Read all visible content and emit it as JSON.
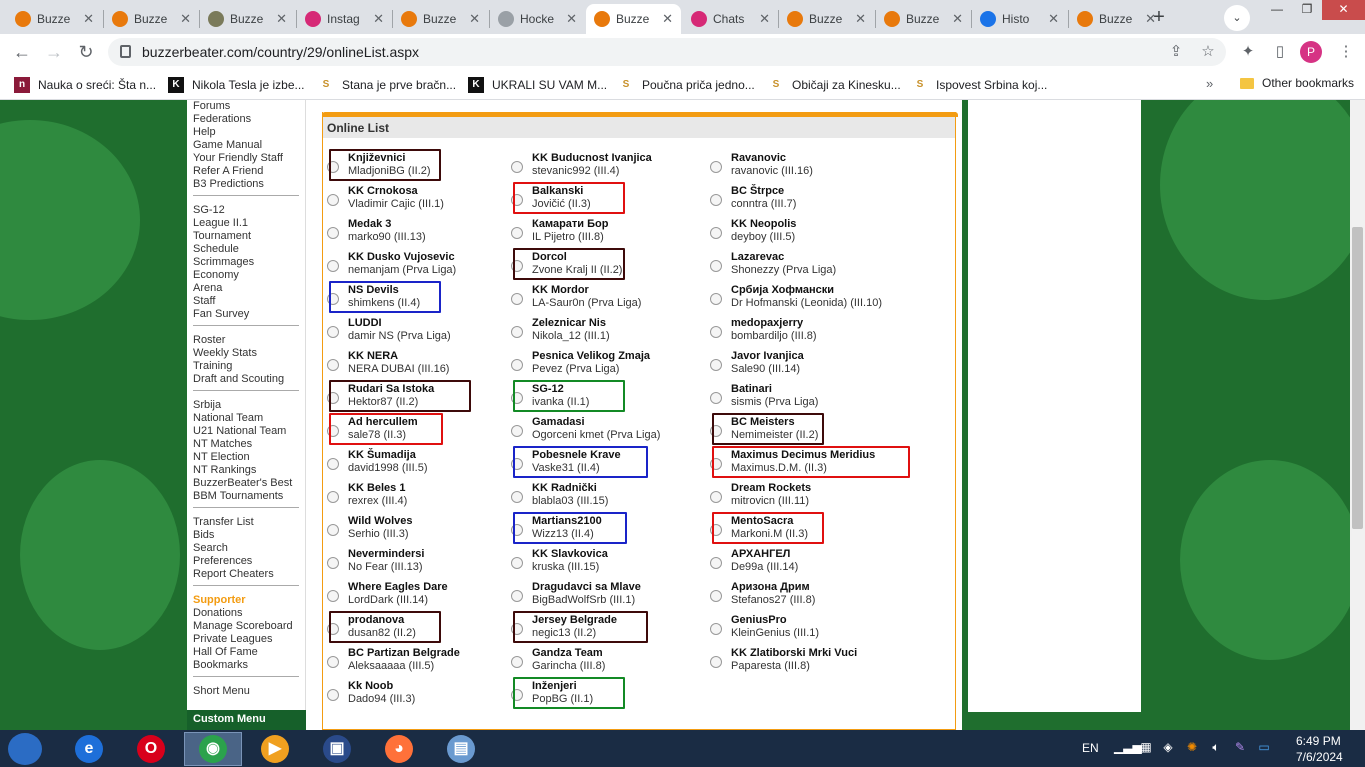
{
  "browser": {
    "tabs": [
      {
        "title": "Buzze",
        "favicon": "basketball-icon",
        "color": "#e8790c"
      },
      {
        "title": "Buzze",
        "favicon": "basketball-icon",
        "color": "#e8790c"
      },
      {
        "title": "Buzze",
        "favicon": "bm-icon",
        "color": "#7a7a5a"
      },
      {
        "title": "Instag",
        "favicon": "instagram-icon",
        "color": "#d62976"
      },
      {
        "title": "Buzze",
        "favicon": "basketball-icon",
        "color": "#e8790c"
      },
      {
        "title": "Hocke",
        "favicon": "link-icon",
        "color": "#9aa0a6"
      },
      {
        "title": "Buzze",
        "favicon": "basketball-icon",
        "color": "#e8790c"
      },
      {
        "title": "Chats",
        "favicon": "instagram-icon",
        "color": "#d62976"
      },
      {
        "title": "Buzze",
        "favicon": "basketball-icon",
        "color": "#e8790c"
      },
      {
        "title": "Buzze",
        "favicon": "basketball-icon",
        "color": "#e8790c"
      },
      {
        "title": "Histo",
        "favicon": "history-icon",
        "color": "#1a73e8"
      },
      {
        "title": "Buzze",
        "favicon": "basketball-icon",
        "color": "#e8790c"
      }
    ],
    "active_tab": 6,
    "url": "buzzerbeater.com/country/29/onlineList.aspx",
    "profile_initial": "P",
    "bookmarks": [
      {
        "label": "Nauka o sreći: Šta n...",
        "icon": "n-icon",
        "glyph": "n",
        "bg": "#8b1a3a",
        "fg": "#fff"
      },
      {
        "label": "Nikola Tesla je izbe...",
        "icon": "k-icon",
        "glyph": "K",
        "bg": "#111",
        "fg": "#fff"
      },
      {
        "label": "Stana je prve bračn...",
        "icon": "s-icon",
        "glyph": "S",
        "bg": "transparent",
        "fg": "#c8912a"
      },
      {
        "label": "UKRALI SU VAM M...",
        "icon": "k-icon",
        "glyph": "K",
        "bg": "#111",
        "fg": "#fff"
      },
      {
        "label": "Poučna priča jedno...",
        "icon": "s-icon",
        "glyph": "S",
        "bg": "transparent",
        "fg": "#c8912a"
      },
      {
        "label": "Običaji za Kinesku...",
        "icon": "s-icon",
        "glyph": "S",
        "bg": "transparent",
        "fg": "#c8912a"
      },
      {
        "label": "Ispovest Srbina koj...",
        "icon": "s-icon",
        "glyph": "S",
        "bg": "transparent",
        "fg": "#c8912a"
      }
    ],
    "more_bookmarks": "»",
    "other_bookmarks": "Other bookmarks"
  },
  "sidebar": {
    "groups": [
      [
        "Forums",
        "Federations",
        "Help",
        "Game Manual",
        "Your Friendly Staff",
        "Refer A Friend",
        "B3 Predictions"
      ],
      [
        "SG-12",
        "League II.1",
        "Tournament",
        "Schedule",
        "Scrimmages",
        "Economy",
        "Arena",
        "Staff",
        "Fan Survey"
      ],
      [
        "Roster",
        "Weekly Stats",
        "Training",
        "Draft and Scouting"
      ],
      [
        "Srbija",
        "National Team",
        "U21 National Team",
        "NT Matches",
        "NT Election",
        "NT Rankings",
        "BuzzerBeater's Best",
        "BBM Tournaments"
      ],
      [
        "Transfer List",
        "Bids",
        "Search",
        "Preferences",
        "Report Cheaters"
      ],
      [
        "Supporter",
        "Donations",
        "Manage Scoreboard",
        "Private Leagues",
        "Hall Of Fame",
        "Bookmarks"
      ],
      [
        "Short Menu"
      ]
    ],
    "custom_menu": "Custom Menu"
  },
  "online_list": {
    "title": "Online List",
    "columns": [
      [
        {
          "team": "Književnici",
          "manager": "MladjoniBG (II.2)",
          "highlight": "dark"
        },
        {
          "team": "KK Crnokosa",
          "manager": "Vladimir Cajic (III.1)",
          "highlight": ""
        },
        {
          "team": "Medak 3",
          "manager": "marko90 (III.13)",
          "highlight": ""
        },
        {
          "team": "KK Dusko Vujosevic",
          "manager": "nemanjam (Prva Liga)",
          "highlight": ""
        },
        {
          "team": "NS Devils",
          "manager": "shimkens (II.4)",
          "highlight": "blue"
        },
        {
          "team": "LUDDI",
          "manager": "damir NS (Prva Liga)",
          "highlight": ""
        },
        {
          "team": "KK NERA",
          "manager": "NERA DUBAI (III.16)",
          "highlight": ""
        },
        {
          "team": "Rudari Sa Istoka",
          "manager": "Hektor87 (II.2)",
          "highlight": "dark"
        },
        {
          "team": "Ad hercullem",
          "manager": "sale78 (II.3)",
          "highlight": "red"
        },
        {
          "team": "KK Šumadija",
          "manager": "david1998 (III.5)",
          "highlight": ""
        },
        {
          "team": "KK Beles 1",
          "manager": "rexrex (III.4)",
          "highlight": ""
        },
        {
          "team": "Wild Wolves",
          "manager": "Serhio (III.3)",
          "highlight": ""
        },
        {
          "team": "Nevermindersi",
          "manager": "No Fear (III.13)",
          "highlight": ""
        },
        {
          "team": "Where Eagles Dare",
          "manager": "LordDark (III.14)",
          "highlight": ""
        },
        {
          "team": "prodanova",
          "manager": "dusan82 (II.2)",
          "highlight": "dark"
        },
        {
          "team": "BC Partizan Belgrade",
          "manager": "Aleksaaaaa (III.5)",
          "highlight": ""
        },
        {
          "team": "Kk Noob",
          "manager": "Dado94 (III.3)",
          "highlight": ""
        }
      ],
      [
        {
          "team": "KK Buducnost Ivanjica",
          "manager": "stevanic992 (III.4)",
          "highlight": ""
        },
        {
          "team": "Balkanski",
          "manager": "Jovičić (II.3)",
          "highlight": "red"
        },
        {
          "team": "Камарати Бор",
          "manager": "IL Pijetro (III.8)",
          "highlight": ""
        },
        {
          "team": "Dorcol",
          "manager": "Zvone Kralj II (II.2)",
          "highlight": "dark"
        },
        {
          "team": "KK Mordor",
          "manager": "LA-Saur0n (Prva Liga)",
          "highlight": ""
        },
        {
          "team": "Zeleznicar Nis",
          "manager": "Nikola_12 (III.1)",
          "highlight": ""
        },
        {
          "team": "Pesnica Velikog Zmaja",
          "manager": "Pevez (Prva Liga)",
          "highlight": ""
        },
        {
          "team": "SG-12",
          "manager": "ivanka (II.1)",
          "highlight": "green"
        },
        {
          "team": "Gamadasi",
          "manager": "Ogorceni kmet (Prva Liga)",
          "highlight": ""
        },
        {
          "team": "Pobesnele Krave",
          "manager": "Vaske31 (II.4)",
          "highlight": "blue"
        },
        {
          "team": "KK Radnički",
          "manager": "blabla03 (III.15)",
          "highlight": ""
        },
        {
          "team": "Martians2100",
          "manager": "Wizz13 (II.4)",
          "highlight": "blue"
        },
        {
          "team": "KK Slavkovica",
          "manager": "kruska (III.15)",
          "highlight": ""
        },
        {
          "team": "Dragudavci sa Mlave",
          "manager": "BigBadWolfSrb (III.1)",
          "highlight": ""
        },
        {
          "team": "Jersey Belgrade",
          "manager": "negic13 (II.2)",
          "highlight": "dark"
        },
        {
          "team": "Gandza Team",
          "manager": "Garincha (III.8)",
          "highlight": ""
        },
        {
          "team": "Inženjeri",
          "manager": "PopBG (II.1)",
          "highlight": "green"
        }
      ],
      [
        {
          "team": "Ravanovic",
          "manager": "ravanovic (III.16)",
          "highlight": ""
        },
        {
          "team": "BC Štrpce",
          "manager": "conntra (III.7)",
          "highlight": ""
        },
        {
          "team": "KK Neopolis",
          "manager": "deyboy (III.5)",
          "highlight": ""
        },
        {
          "team": "Lazarevac",
          "manager": "Shonezzy (Prva Liga)",
          "highlight": ""
        },
        {
          "team": "Србија Хофмански",
          "manager": "Dr Hofmanski (Leonida) (III.10)",
          "highlight": ""
        },
        {
          "team": "medopaxjerry",
          "manager": "bombardiljo (III.8)",
          "highlight": ""
        },
        {
          "team": "Javor Ivanjica",
          "manager": "Sale90 (III.14)",
          "highlight": ""
        },
        {
          "team": "Batinari",
          "manager": "sismis (Prva Liga)",
          "highlight": ""
        },
        {
          "team": "BC Meisters",
          "manager": "Nemimeister (II.2)",
          "highlight": "dark"
        },
        {
          "team": "Maximus Decimus Meridius",
          "manager": "Maximus.D.M. (II.3)",
          "highlight": "red"
        },
        {
          "team": "Dream Rockets",
          "manager": "mitrovicn (III.11)",
          "highlight": ""
        },
        {
          "team": "MentoSacra",
          "manager": "Markoni.M (II.3)",
          "highlight": "red"
        },
        {
          "team": "АРХАНГЕЛ",
          "manager": "De99a (III.14)",
          "highlight": ""
        },
        {
          "team": "Аризона Дрим",
          "manager": "Stefanos27 (III.8)",
          "highlight": ""
        },
        {
          "team": "GeniusPro",
          "manager": "KleinGenius (III.1)",
          "highlight": ""
        },
        {
          "team": "KK Zlatiborski Mrki Vuci",
          "manager": "Paparesta (III.8)",
          "highlight": ""
        }
      ]
    ]
  },
  "taskbar": {
    "apps": [
      {
        "name": "internet-explorer-icon",
        "glyph": "e",
        "color": "#1e6fd9"
      },
      {
        "name": "opera-icon",
        "glyph": "O",
        "color": "#d8001b"
      },
      {
        "name": "chrome-icon",
        "glyph": "◉",
        "color": "#2ba24c"
      },
      {
        "name": "media-player-icon",
        "glyph": "▶",
        "color": "#f0a020"
      },
      {
        "name": "save-disk-icon",
        "glyph": "▣",
        "color": "#2a4a8a"
      },
      {
        "name": "firefox-icon",
        "glyph": "◕",
        "color": "#ff7139"
      },
      {
        "name": "notepad-icon",
        "glyph": "▤",
        "color": "#6a9ad0"
      }
    ],
    "active_app": 2,
    "lang": "EN",
    "time": "6:49 PM",
    "date": "7/6/2024"
  }
}
